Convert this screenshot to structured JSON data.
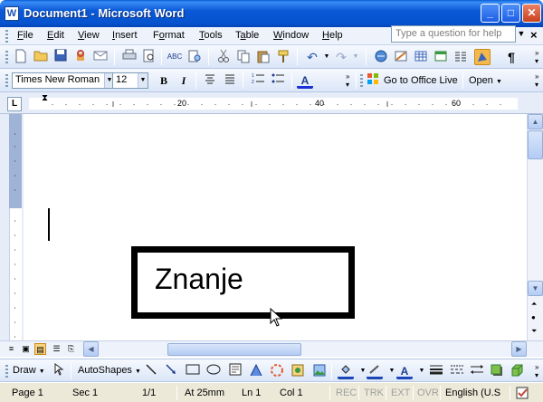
{
  "window": {
    "app_icon": "W",
    "title": "Document1 - Microsoft Word",
    "controls": {
      "minimize": "_",
      "maximize": "□",
      "close": "✕"
    }
  },
  "menu": {
    "items": [
      {
        "label": "File",
        "key": "F",
        "rest": "ile"
      },
      {
        "label": "Edit",
        "key": "E",
        "rest": "dit"
      },
      {
        "label": "View",
        "key": "V",
        "rest": "iew"
      },
      {
        "label": "Insert",
        "key": "I",
        "rest": "nsert"
      },
      {
        "label": "Format",
        "key": "o",
        "pre": "F",
        "rest": "rmat"
      },
      {
        "label": "Tools",
        "key": "T",
        "rest": "ools"
      },
      {
        "label": "Table",
        "key": "a",
        "pre": "T",
        "rest": "ble"
      },
      {
        "label": "Window",
        "key": "W",
        "rest": "indow"
      },
      {
        "label": "Help",
        "key": "H",
        "rest": "elp"
      }
    ],
    "help_placeholder": "Type a question for help",
    "close_doc": "×"
  },
  "formatting": {
    "font_name": "Times New Roman",
    "font_size": "12",
    "bold": "B",
    "italic": "I",
    "office_live": "Go to Office Live",
    "open": "Open"
  },
  "ruler": {
    "tab_marker": "L",
    "marks": [
      "20",
      "40",
      "60"
    ]
  },
  "document": {
    "textbox_text": "Znanje"
  },
  "drawing": {
    "draw": "Draw",
    "autoshapes": "AutoShapes"
  },
  "status": {
    "page": "Page 1",
    "sec": "Sec 1",
    "of": "1/1",
    "at": "At 25mm",
    "ln": "Ln 1",
    "col": "Col 1",
    "rec": "REC",
    "trk": "TRK",
    "ext": "EXT",
    "ovr": "OVR",
    "language": "English (U.S"
  },
  "colors": {
    "titlebar": "#0a58d6",
    "toolbar": "#dbe6f8",
    "statusbar": "#ece9d8"
  },
  "icons": [
    "new-icon",
    "open-icon",
    "save-icon",
    "permission-icon",
    "email-icon",
    "print-icon",
    "print-preview-icon",
    "spelling-icon",
    "research-icon",
    "cut-icon",
    "copy-icon",
    "paste-icon",
    "format-painter-icon",
    "undo-icon",
    "redo-icon",
    "hyperlink-icon",
    "tables-borders-icon",
    "insert-table-icon",
    "insert-excel-icon",
    "columns-icon",
    "drawing-icon",
    "show-formatting-icon"
  ]
}
